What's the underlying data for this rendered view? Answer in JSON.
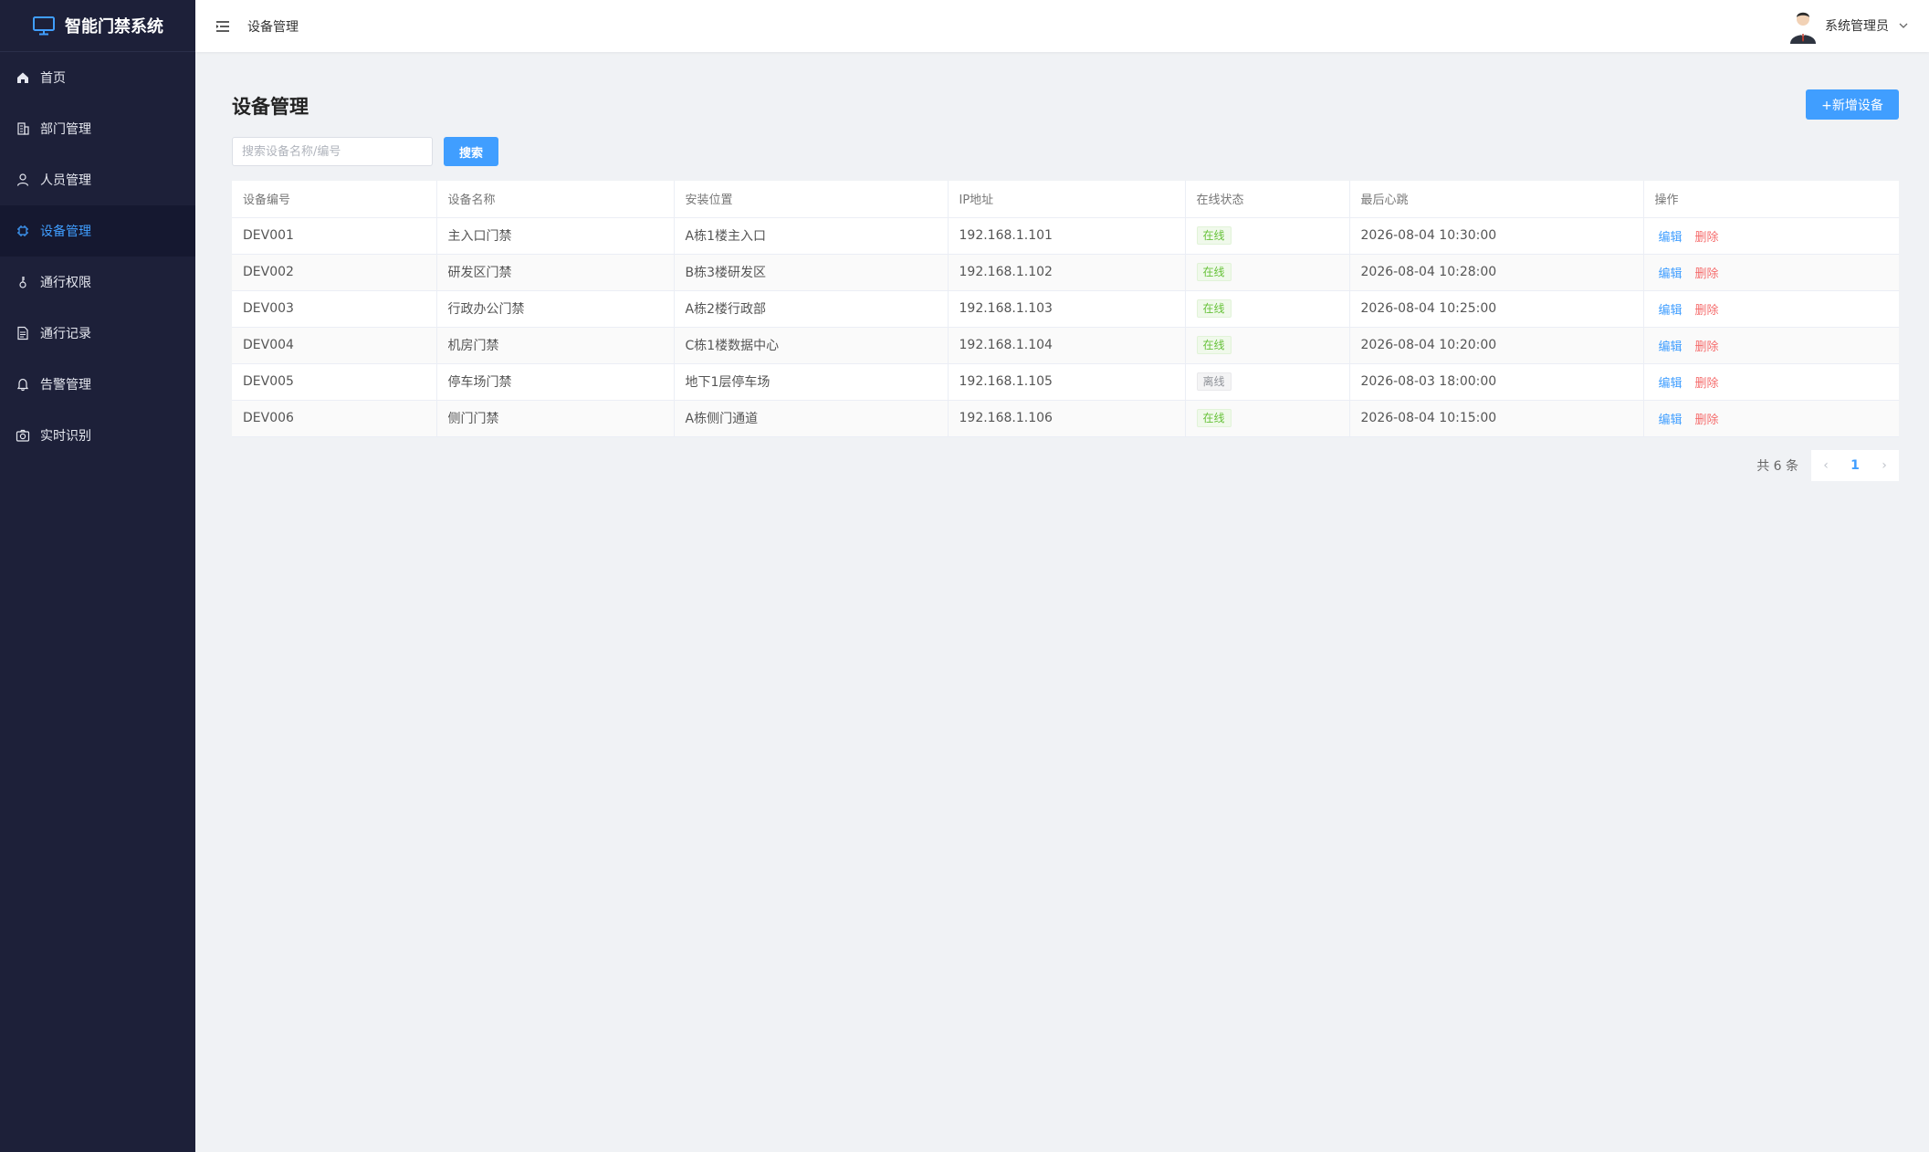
{
  "app": {
    "title": "智能门禁系统"
  },
  "sidebar": {
    "items": [
      {
        "label": "首页",
        "icon": "home-icon"
      },
      {
        "label": "部门管理",
        "icon": "building-icon"
      },
      {
        "label": "人员管理",
        "icon": "user-icon"
      },
      {
        "label": "设备管理",
        "icon": "chip-icon",
        "active": true
      },
      {
        "label": "通行权限",
        "icon": "key-icon"
      },
      {
        "label": "通行记录",
        "icon": "document-icon"
      },
      {
        "label": "告警管理",
        "icon": "bell-icon"
      },
      {
        "label": "实时识别",
        "icon": "camera-icon"
      }
    ]
  },
  "header": {
    "breadcrumb": "设备管理",
    "user_name": "系统管理员"
  },
  "main": {
    "title": "设备管理",
    "add_button": "+新增设备",
    "search": {
      "placeholder": "搜索设备名称/编号",
      "value": "",
      "button": "搜索"
    },
    "table": {
      "columns": [
        "设备编号",
        "设备名称",
        "安装位置",
        "IP地址",
        "在线状态",
        "最后心跳",
        "操作"
      ],
      "rows": [
        {
          "id": "DEV001",
          "name": "主入口门禁",
          "location": "A栋1楼主入口",
          "ip": "192.168.1.101",
          "status": "在线",
          "online": true,
          "heartbeat": "2026-08-04 10:30:00",
          "edit": "编辑",
          "delete": "删除"
        },
        {
          "id": "DEV002",
          "name": "研发区门禁",
          "location": "B栋3楼研发区",
          "ip": "192.168.1.102",
          "status": "在线",
          "online": true,
          "heartbeat": "2026-08-04 10:28:00",
          "edit": "编辑",
          "delete": "删除"
        },
        {
          "id": "DEV003",
          "name": "行政办公门禁",
          "location": "A栋2楼行政部",
          "ip": "192.168.1.103",
          "status": "在线",
          "online": true,
          "heartbeat": "2026-08-04 10:25:00",
          "edit": "编辑",
          "delete": "删除"
        },
        {
          "id": "DEV004",
          "name": "机房门禁",
          "location": "C栋1楼数据中心",
          "ip": "192.168.1.104",
          "status": "在线",
          "online": true,
          "heartbeat": "2026-08-04 10:20:00",
          "edit": "编辑",
          "delete": "删除"
        },
        {
          "id": "DEV005",
          "name": "停车场门禁",
          "location": "地下1层停车场",
          "ip": "192.168.1.105",
          "status": "离线",
          "online": false,
          "heartbeat": "2026-08-03 18:00:00",
          "edit": "编辑",
          "delete": "删除"
        },
        {
          "id": "DEV006",
          "name": "侧门门禁",
          "location": "A栋侧门通道",
          "ip": "192.168.1.106",
          "status": "在线",
          "online": true,
          "heartbeat": "2026-08-04 10:15:00",
          "edit": "编辑",
          "delete": "删除"
        }
      ]
    },
    "pagination": {
      "total_text": "共 6 条",
      "current_page": "1",
      "prev": "‹",
      "next": "›"
    }
  },
  "colors": {
    "sidebar_bg": "#1d2039",
    "accent": "#409eff",
    "danger": "#f56c6c",
    "success": "#67c23a"
  }
}
